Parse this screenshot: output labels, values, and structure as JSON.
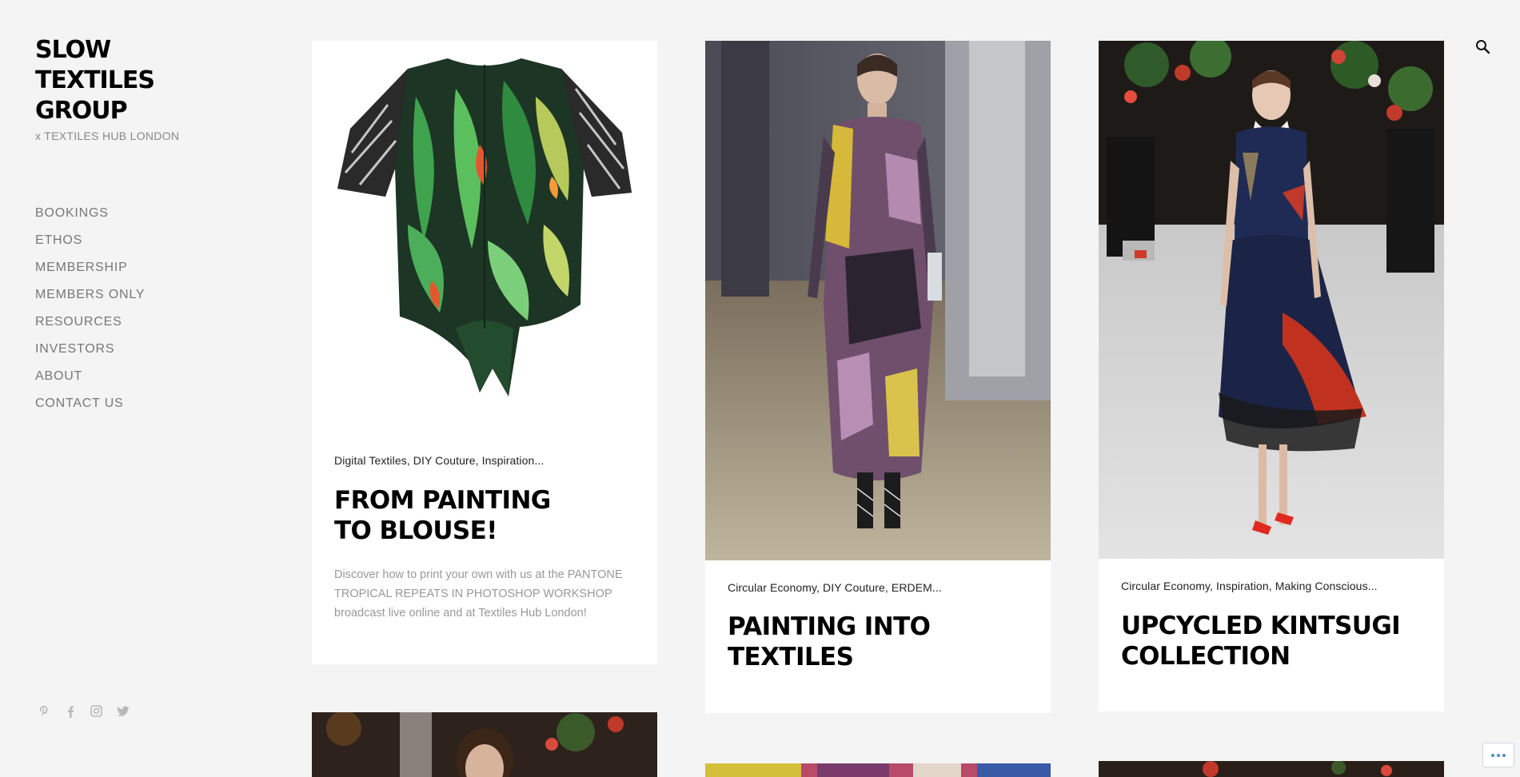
{
  "site": {
    "title": "SLOW TEXTILES GROUP",
    "tagline": "x TEXTILES HUB LONDON"
  },
  "nav": [
    {
      "label": "BOOKINGS"
    },
    {
      "label": "ETHOS"
    },
    {
      "label": "MEMBERSHIP"
    },
    {
      "label": "MEMBERS ONLY"
    },
    {
      "label": "RESOURCES"
    },
    {
      "label": "INVESTORS"
    },
    {
      "label": "ABOUT"
    },
    {
      "label": "CONTACT US"
    }
  ],
  "social": [
    "pinterest-icon",
    "facebook-icon",
    "instagram-icon",
    "twitter-icon"
  ],
  "posts": [
    {
      "categories": "Digital Textiles, DIY Couture, Inspiration...",
      "title_line1": "FROM PAINTING",
      "title_line2": "TO BLOUSE!",
      "excerpt": "Discover how to print your own with us at the PANTONE TROPICAL REPEATS IN PHOTOSHOP WORKSHOP broadcast live online and at Textiles Hub London!",
      "image": "tropical-print-blouse"
    },
    {
      "categories": "Circular Economy, DIY Couture, ERDEM...",
      "title_line1": "PAINTING INTO",
      "title_line2": "TEXTILES",
      "image": "runway-velvet-dress"
    },
    {
      "categories": "Circular Economy, Inspiration, Making Conscious...",
      "title_line1": "UPCYCLED KINTSUGI",
      "title_line2": "COLLECTION",
      "image": "runway-tulle-dress"
    }
  ],
  "colors": {
    "background": "#f4f4f4",
    "card": "#ffffff",
    "title": "#000000",
    "nav": "#777777",
    "accent": "#4a90c2"
  }
}
